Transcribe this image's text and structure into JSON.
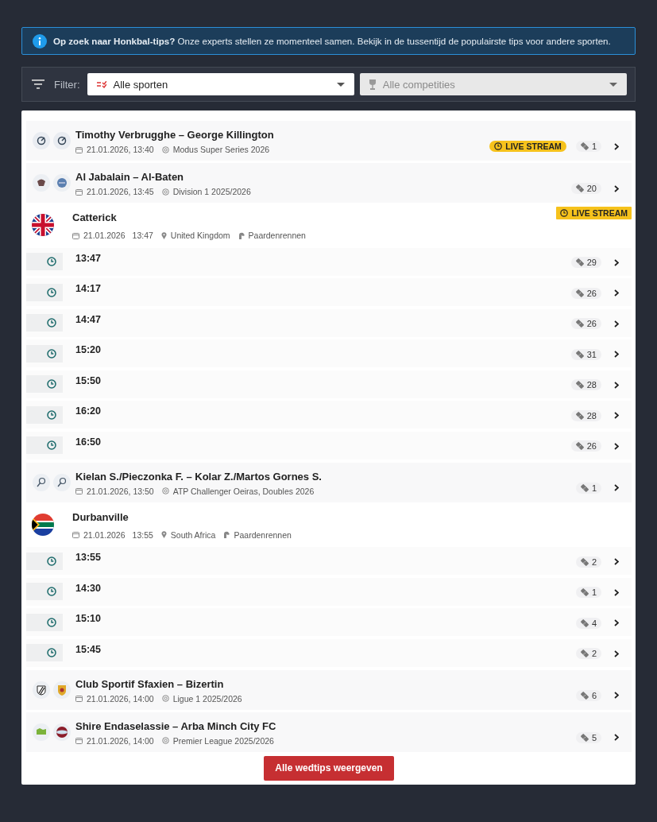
{
  "banner": {
    "text": "**Op zoek naar Honkbal-tips?** Onze experts stellen ze momenteel samen. Bekijk in de tussentijd de populairste tips voor andere sporten."
  },
  "filter": {
    "label": "Filter:",
    "sport_select": {
      "value": "Alle sporten",
      "disabled": false
    },
    "competition_select": {
      "value": "Alle competities",
      "disabled": true
    }
  },
  "items": [
    {
      "kind": "match",
      "title": "Timothy Verbrugghe – George Killington",
      "date": "21.01.2026, 13:40",
      "competition": "Modus Super Series 2026",
      "live_stream": "LIVE STREAM",
      "tips": "1"
    },
    {
      "kind": "match",
      "title": "Al Jabalain – Al-Baten",
      "date": "21.01.2026, 13:45",
      "competition": "Division 1 2025/2026",
      "tips": "20"
    },
    {
      "kind": "race",
      "venue": "Catterick",
      "date": "21.01.2026",
      "time": "13:47",
      "country": "United Kingdom",
      "sport": "Paardenrennen",
      "live_stream": "LIVE STREAM",
      "races": [
        {
          "time": "13:47",
          "tips": "29"
        },
        {
          "time": "14:17",
          "tips": "26"
        },
        {
          "time": "14:47",
          "tips": "26"
        },
        {
          "time": "15:20",
          "tips": "31"
        },
        {
          "time": "15:50",
          "tips": "28"
        },
        {
          "time": "16:20",
          "tips": "28"
        },
        {
          "time": "16:50",
          "tips": "26"
        }
      ]
    },
    {
      "kind": "match",
      "title": "Kielan S./Pieczonka F. – Kolar Z./Martos Gornes S.",
      "date": "21.01.2026, 13:50",
      "competition": "ATP Challenger Oeiras, Doubles 2026",
      "tips": "1"
    },
    {
      "kind": "race",
      "venue": "Durbanville",
      "date": "21.01.2026",
      "time": "13:55",
      "country": "South Africa",
      "sport": "Paardenrennen",
      "races": [
        {
          "time": "13:55",
          "tips": "2"
        },
        {
          "time": "14:30",
          "tips": "1"
        },
        {
          "time": "15:10",
          "tips": "4"
        },
        {
          "time": "15:45",
          "tips": "2"
        }
      ]
    },
    {
      "kind": "match",
      "title": "Club Sportif Sfaxien – Bizertin",
      "date": "21.01.2026, 14:00",
      "competition": "Ligue 1 2025/2026",
      "tips": "6"
    },
    {
      "kind": "match",
      "title": "Shire Endaselassie – Arba Minch City FC",
      "date": "21.01.2026, 14:00",
      "competition": "Premier League 2025/2026",
      "tips": "5"
    }
  ],
  "show_all_button": "Alle wedtips weergeven"
}
